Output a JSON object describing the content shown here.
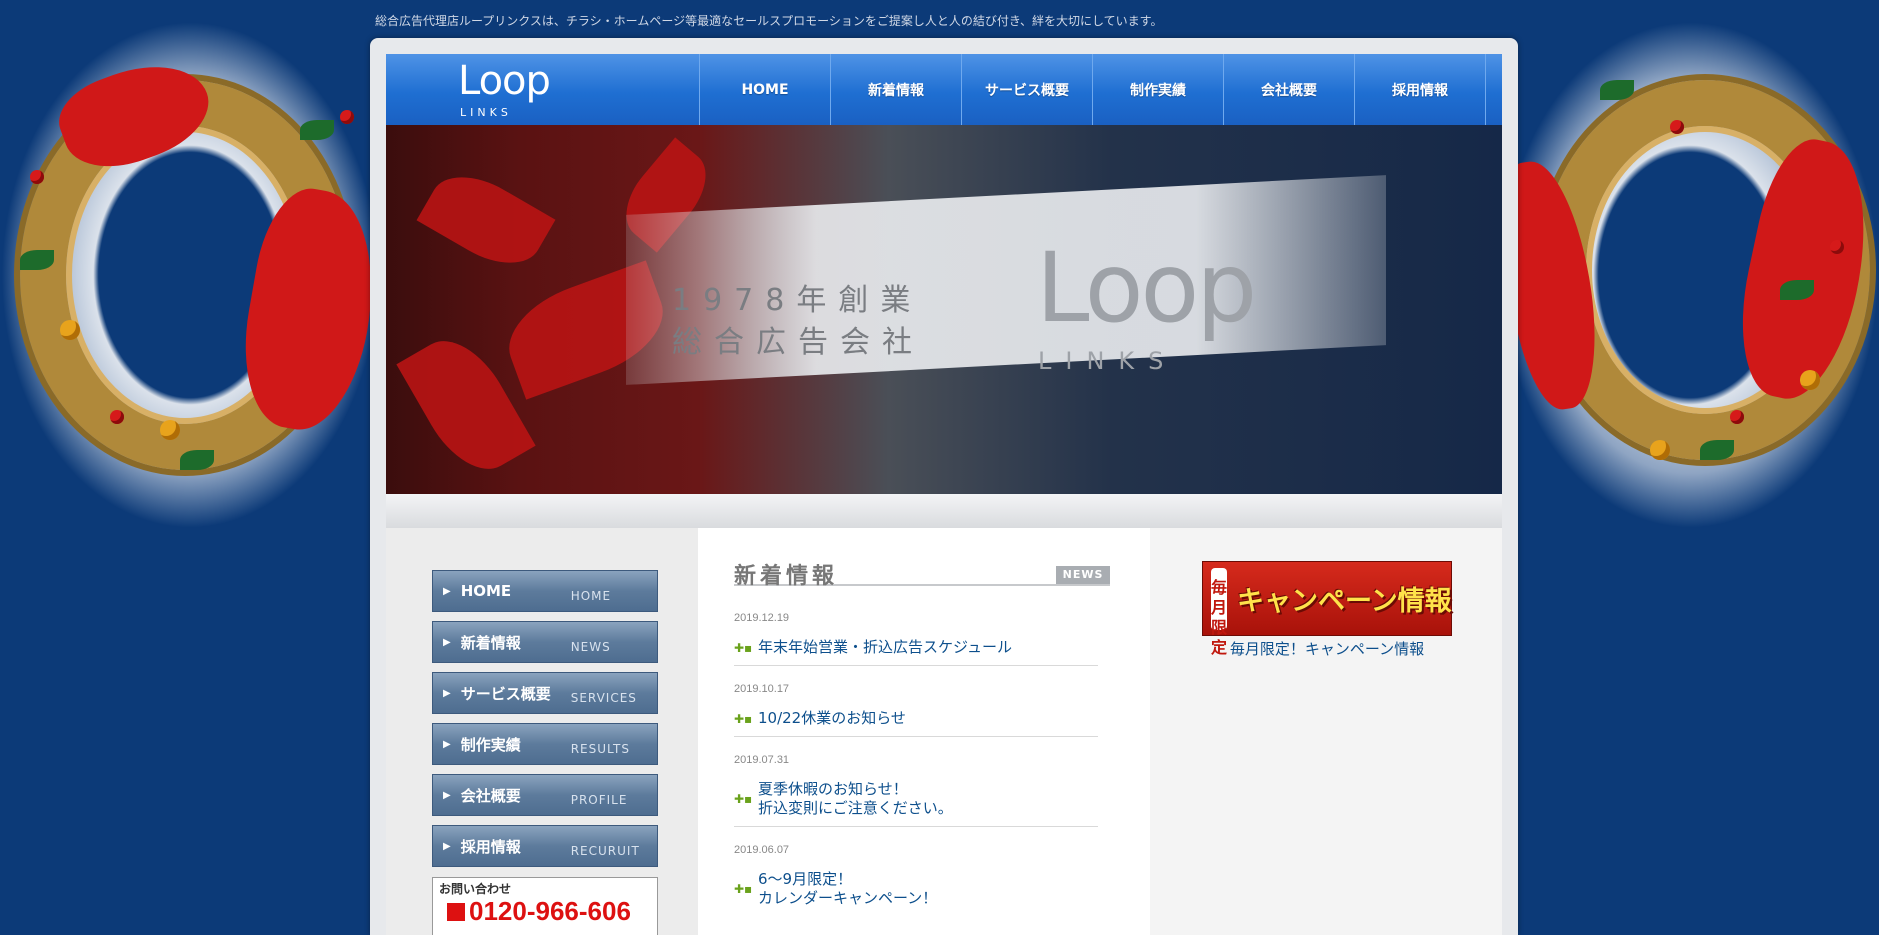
{
  "tagline": "総合広告代理店ループリンクスは、チラシ・ホームページ等最適なセールスプロモーションをご提案し人と人の結び付き、絆を大切にしています。",
  "logo": {
    "text": "Loop",
    "sub": "LINKS"
  },
  "nav": [
    {
      "label": "HOME"
    },
    {
      "label": "新着情報"
    },
    {
      "label": "サービス概要"
    },
    {
      "label": "制作実績"
    },
    {
      "label": "会社概要"
    },
    {
      "label": "採用情報"
    }
  ],
  "hero": {
    "line1": "1978年創業",
    "line2": "総合広告会社",
    "logo": "Loop",
    "logo_sub": "LINKS"
  },
  "sidebar": [
    {
      "jp": "HOME",
      "en": "HOME"
    },
    {
      "jp": "新着情報",
      "en": "NEWS"
    },
    {
      "jp": "サービス概要",
      "en": "SERVICES"
    },
    {
      "jp": "制作実績",
      "en": "RESULTS"
    },
    {
      "jp": "会社概要",
      "en": "PROFILE"
    },
    {
      "jp": "採用情報",
      "en": "RECURUIT"
    }
  ],
  "contact": {
    "label": "お問い合わせ",
    "phone": "0120-966-606"
  },
  "news": {
    "heading": "新着情報",
    "tag": "NEWS",
    "items": [
      {
        "date": "2019.12.19",
        "title": "年末年始営業・折込広告スケジュール"
      },
      {
        "date": "2019.10.17",
        "title": "10/22休業のお知らせ"
      },
      {
        "date": "2019.07.31",
        "title": "夏季休暇のお知らせ！\n折込変則にご注意ください。"
      },
      {
        "date": "2019.06.07",
        "title": "6～9月限定！\nカレンダーキャンペーン！"
      }
    ]
  },
  "campaign": {
    "badge_line1": "毎月",
    "badge_line2": "限定",
    "banner_text": "キャンペーン情報",
    "caption": "毎月限定！キャンペーン情報"
  }
}
